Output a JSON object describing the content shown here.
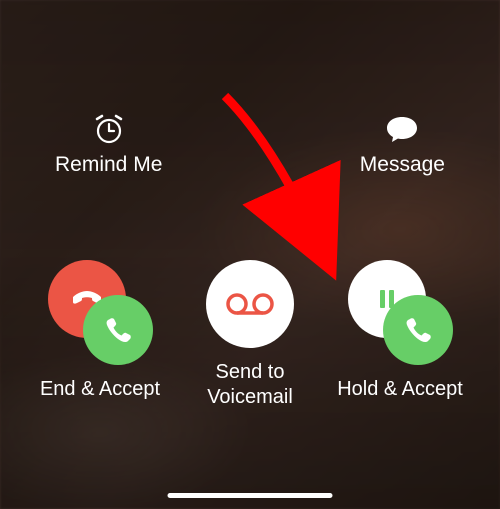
{
  "topActions": {
    "remind": {
      "label": "Remind Me"
    },
    "message": {
      "label": "Message"
    }
  },
  "bottomActions": {
    "endAccept": {
      "label": "End & Accept"
    },
    "voicemail": {
      "label": "Send to\nVoicemail"
    },
    "holdAccept": {
      "label": "Hold & Accept"
    }
  },
  "colors": {
    "decline": "#eb5545",
    "accept": "#67ce67",
    "neutral": "#ffffff"
  },
  "annotation": {
    "arrowTarget": "hold-accept-button",
    "arrowColor": "#ff0000"
  }
}
